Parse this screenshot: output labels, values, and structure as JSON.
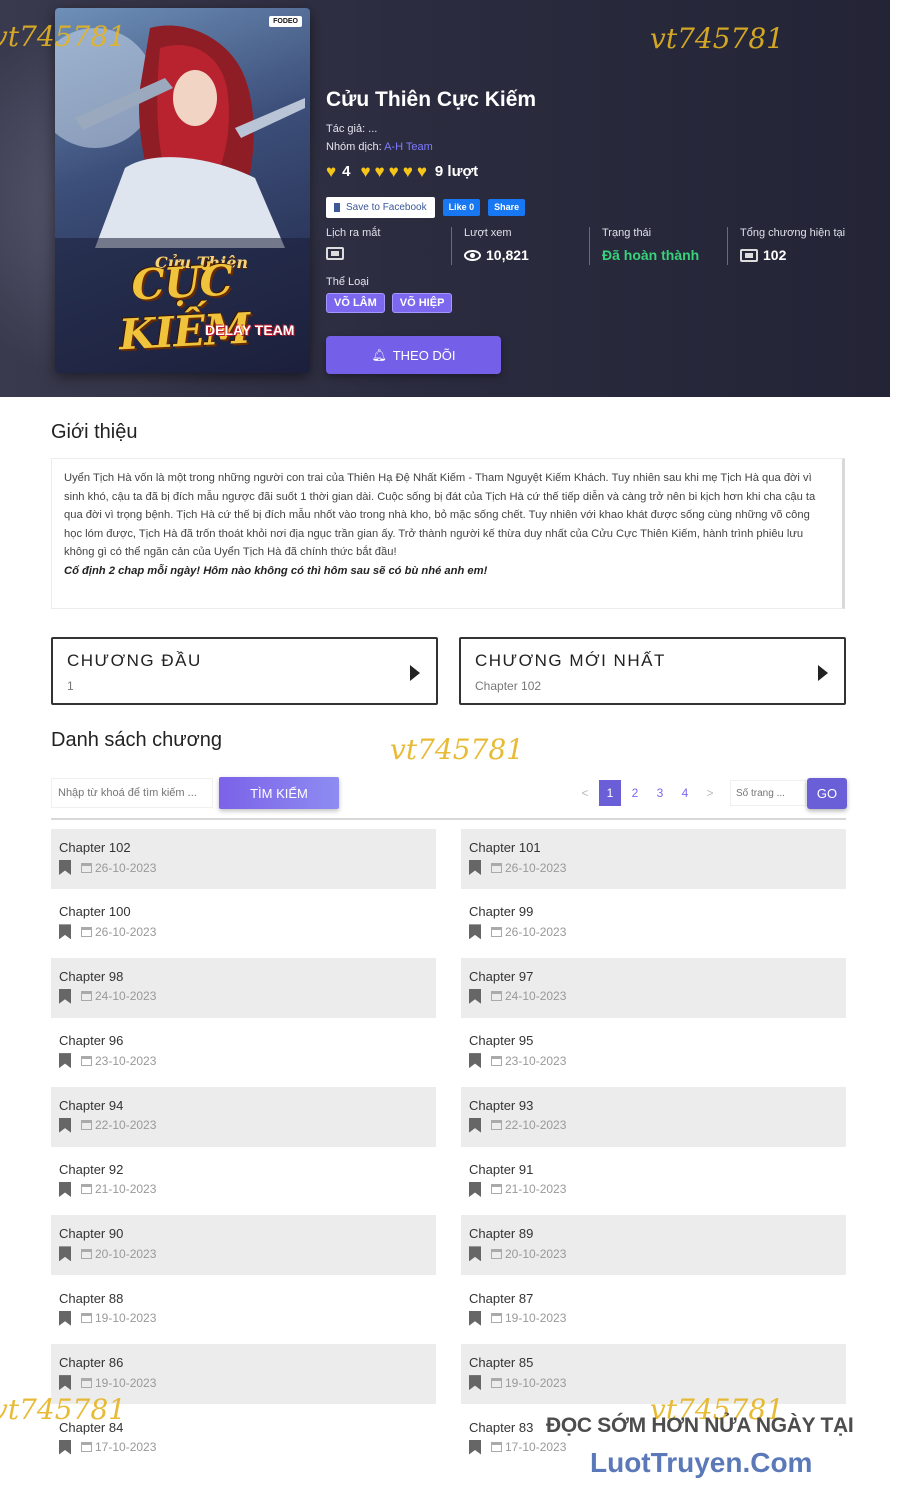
{
  "manga": {
    "title": "Cửu Thiên Cực Kiếm",
    "author_label": "Tác giả: ...",
    "translator_prefix": "Nhóm dịch: ",
    "translator": "A-H Team",
    "rating_value": "4",
    "rating_count": "9 lượt",
    "fb_save": "Save to Facebook",
    "fb_like": "Like 0",
    "fb_share": "Share",
    "stats": {
      "release_label": "Lịch ra mắt",
      "views_label": "Lượt xem",
      "views_value": "10,821",
      "status_label": "Trạng thái",
      "status_value": "Đã hoàn thành",
      "total_label": "Tổng chương hiện tại",
      "total_value": "102"
    },
    "genre_label": "Thể Loại",
    "genres": [
      "VÕ LÂM",
      "VÕ HIỆP"
    ],
    "follow_label": "THEO DÕI",
    "cover": {
      "title_text": "CỰC KIẾM",
      "sub_text": "Cửu Thiên",
      "team_text": "DELAY TEAM",
      "badge_text": "FODEO"
    }
  },
  "watermark": "vt745781",
  "intro": {
    "heading": "Giới thiệu",
    "text": "Uyển Tịch Hà vốn là một trong những người con trai của Thiên Hạ Đệ Nhất Kiếm - Tham Nguyệt Kiếm Khách. Tuy nhiên sau khi mẹ Tịch Hà qua đời vì sinh khó, cậu ta đã bị đích mẫu ngược đãi suốt 1 thời gian dài. Cuộc sống bị đát của Tịch Hà cứ thế tiếp diễn và càng trở nên bi kịch hơn khi cha cậu ta qua đời vì trọng bệnh. Tịch Hà cứ thế bị đích mẫu nhốt vào trong nhà kho, bỏ mặc sống chết. Tuy nhiên với khao khát được sống cùng những võ công học lóm được, Tịch Hà đã trốn thoát khỏi nơi địa ngục trần gian ấy. Trở thành người kế thừa duy nhất của Cửu Cực Thiên Kiếm, hành trình phiêu lưu không gì có thể ngăn cản của Uyển Tịch Hà đã chính thức bắt đầu!",
    "note": "Cố định 2 chap mỗi ngày! Hôm nào không có thì hôm sau sẽ có bù nhé anh em!"
  },
  "first_chapter": {
    "title": "CHƯƠNG ĐẦU",
    "value": "1"
  },
  "latest_chapter": {
    "title": "CHƯƠNG MỚI NHẤT",
    "value": "Chapter 102"
  },
  "chapter_list": {
    "heading": "Danh sách chương",
    "search_placeholder": "Nhập từ khoá để tìm kiếm ...",
    "search_button": "TÌM KIẾM",
    "pagination": [
      "<",
      "1",
      "2",
      "3",
      "4",
      ">"
    ],
    "page_placeholder": "Số trang ...",
    "go_button": "GO",
    "items": [
      {
        "name": "Chapter 102",
        "date": "26-10-2023"
      },
      {
        "name": "Chapter 101",
        "date": "26-10-2023"
      },
      {
        "name": "Chapter 100",
        "date": "26-10-2023"
      },
      {
        "name": "Chapter 99",
        "date": "26-10-2023"
      },
      {
        "name": "Chapter 98",
        "date": "24-10-2023"
      },
      {
        "name": "Chapter 97",
        "date": "24-10-2023"
      },
      {
        "name": "Chapter 96",
        "date": "23-10-2023"
      },
      {
        "name": "Chapter 95",
        "date": "23-10-2023"
      },
      {
        "name": "Chapter 94",
        "date": "22-10-2023"
      },
      {
        "name": "Chapter 93",
        "date": "22-10-2023"
      },
      {
        "name": "Chapter 92",
        "date": "21-10-2023"
      },
      {
        "name": "Chapter 91",
        "date": "21-10-2023"
      },
      {
        "name": "Chapter 90",
        "date": "20-10-2023"
      },
      {
        "name": "Chapter 89",
        "date": "20-10-2023"
      },
      {
        "name": "Chapter 88",
        "date": "19-10-2023"
      },
      {
        "name": "Chapter 87",
        "date": "19-10-2023"
      },
      {
        "name": "Chapter 86",
        "date": "19-10-2023"
      },
      {
        "name": "Chapter 85",
        "date": "19-10-2023"
      },
      {
        "name": "Chapter 84",
        "date": "17-10-2023"
      },
      {
        "name": "Chapter 83",
        "date": "17-10-2023"
      }
    ]
  },
  "promo": {
    "line1": "ĐỌC SỚM HƠN NỬA NGÀY TẠI",
    "line2": "LuotTruyen.Com"
  },
  "colors": {
    "accent": "#7460e8",
    "header_bg": "#2b2c3f",
    "status_green": "#38d27a",
    "heart_yellow": "#f5c518",
    "watermark": "#e6b422"
  }
}
